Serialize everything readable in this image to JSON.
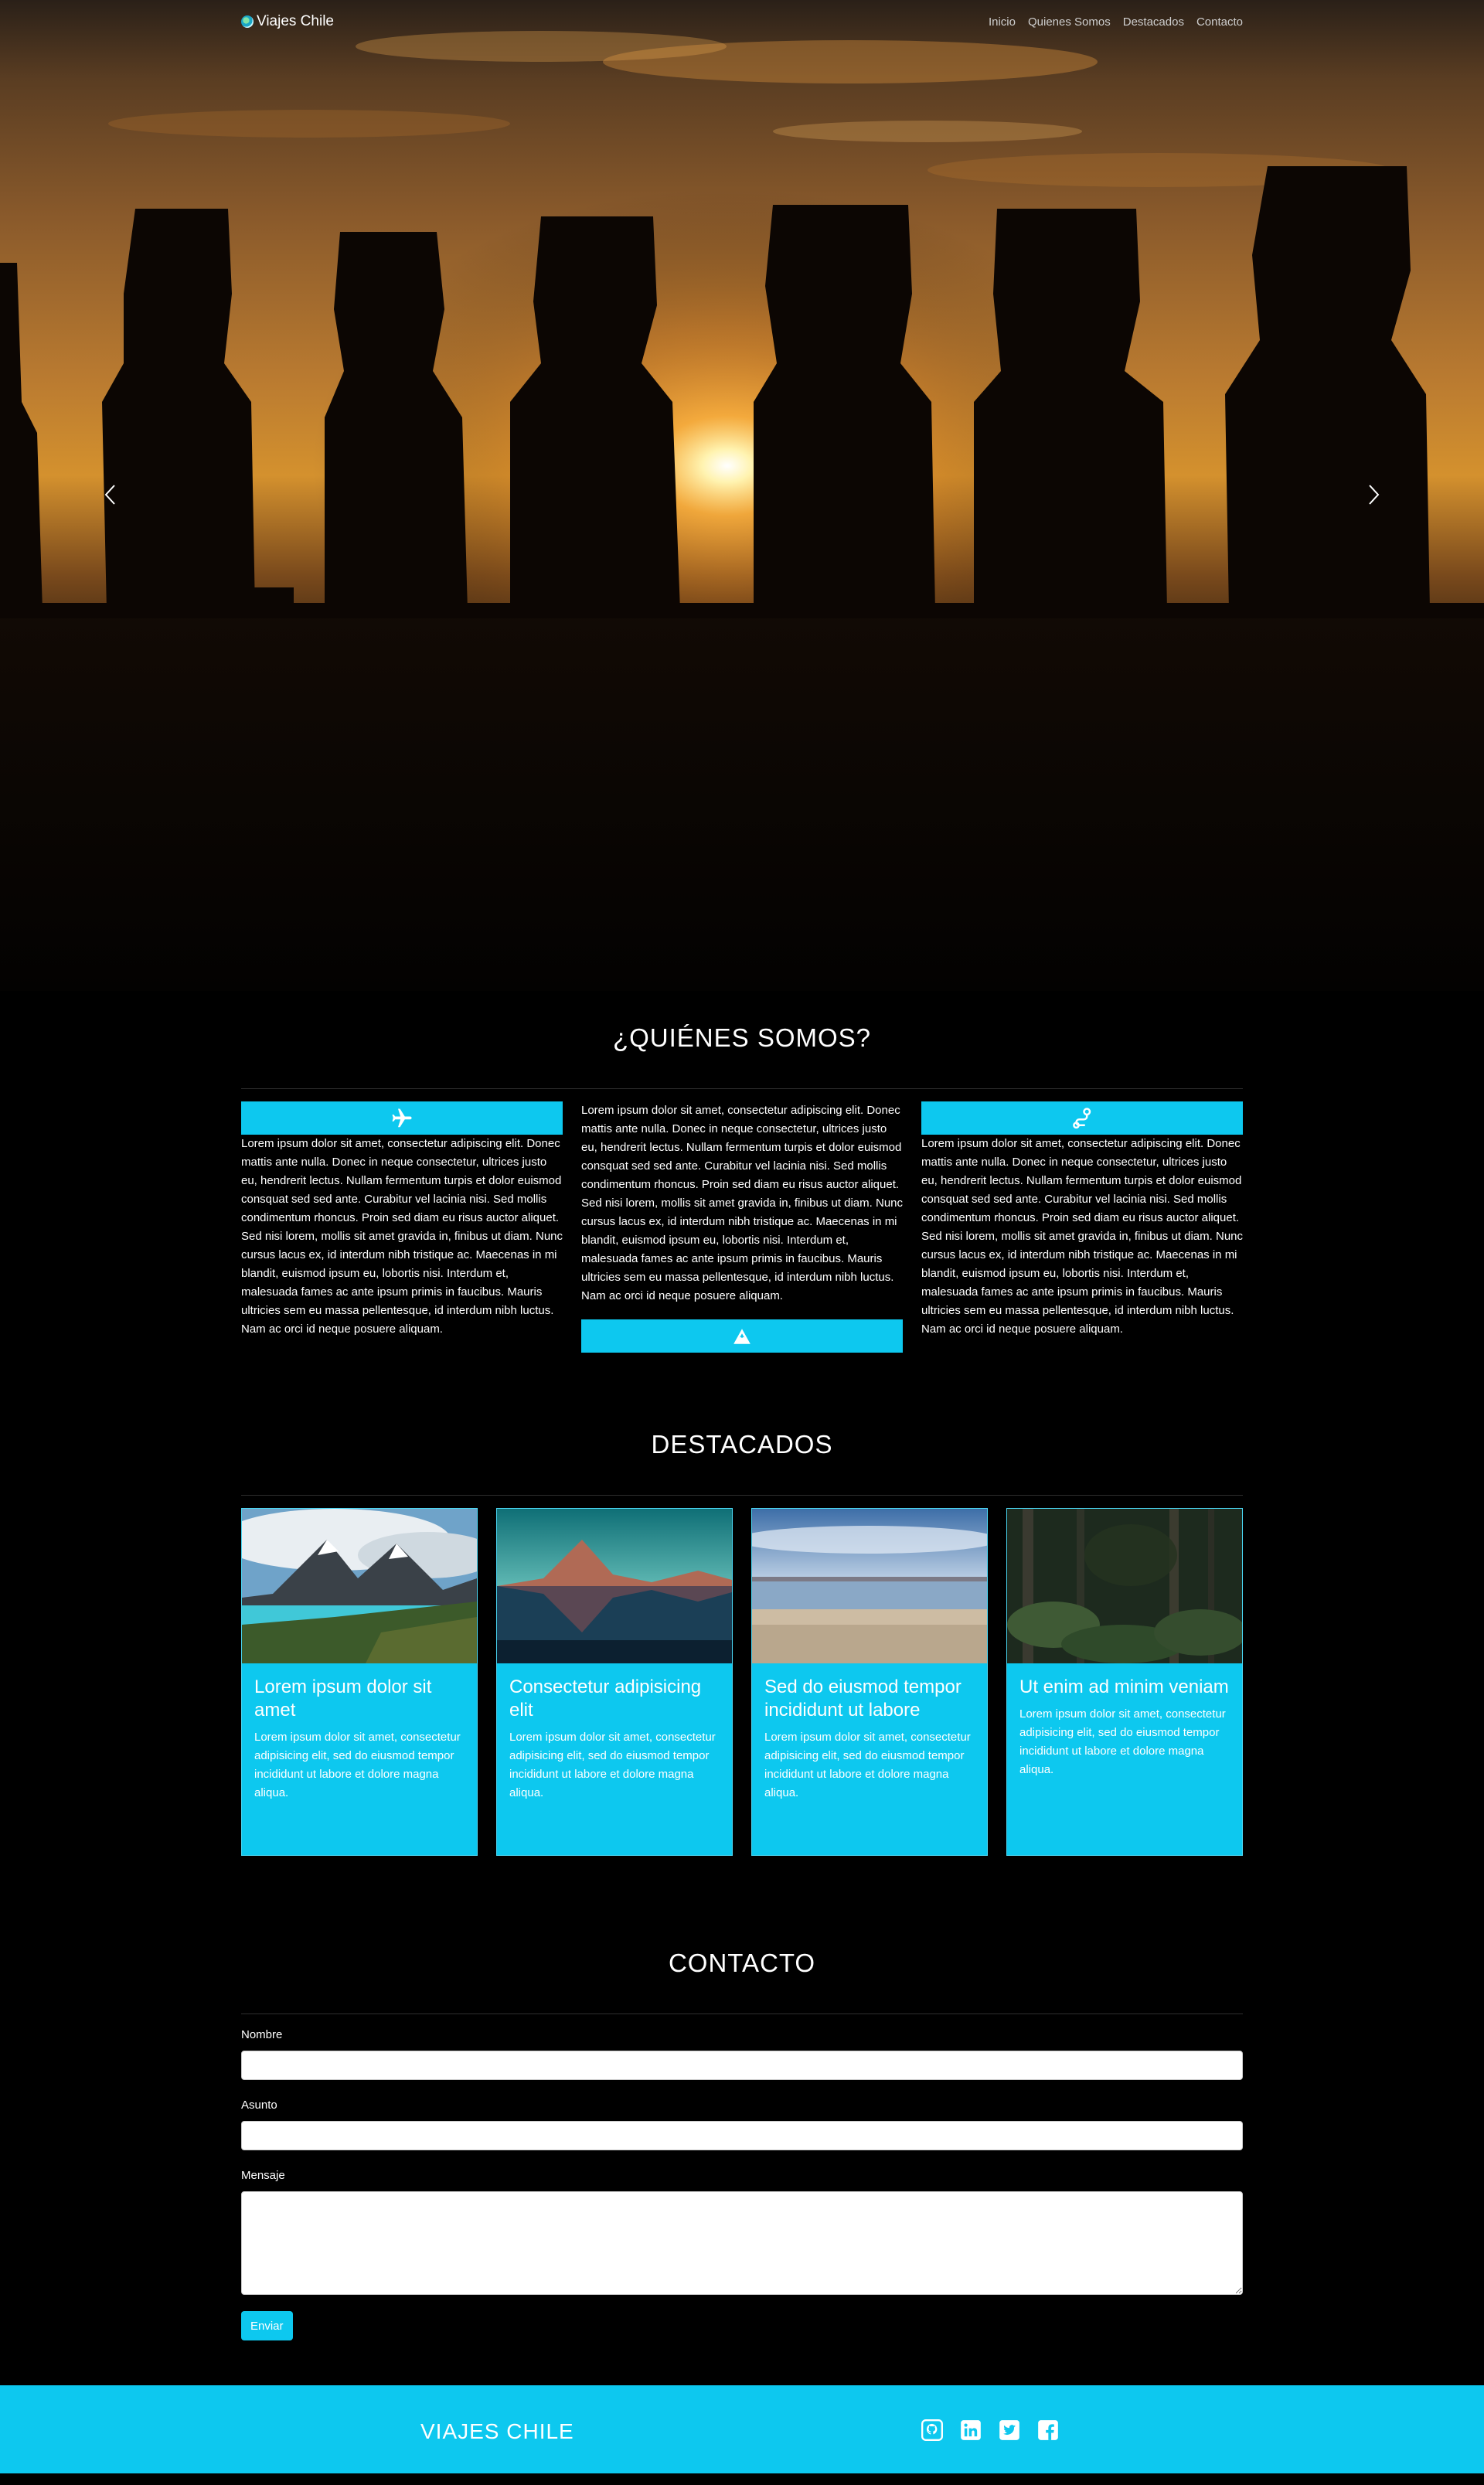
{
  "nav": {
    "brand": "Viajes Chile",
    "links": [
      "Inicio",
      "Quienes Somos",
      "Destacados",
      "Contacto"
    ]
  },
  "hero": {
    "image": "Silhouettes of moai statues against sunset",
    "prev_icon": "chevron-left-icon",
    "next_icon": "chevron-right-icon"
  },
  "about": {
    "title": "¿QUIÉNES SOMOS?",
    "text": "Lorem ipsum dolor sit amet, consectetur adipiscing elit. Donec mattis ante nulla. Donec in neque consectetur, ultrices justo eu, hendrerit lectus. Nullam fermentum turpis et dolor euismod consquat sed sed ante. Curabitur vel lacinia nisi. Sed mollis condimentum rhoncus. Proin sed diam eu risus auctor aliquet. Sed nisi lorem, mollis sit amet gravida in, finibus ut diam. Nunc cursus lacus ex, id interdum nibh tristique ac. Maecenas in mi blandit, euismod ipsum eu, lobortis nisi. Interdum et, malesuada fames ac ante ipsum primis in faucibus. Mauris ultricies sem eu massa pellentesque, id interdum nibh luctus. Nam ac orci id neque posuere aliquam.",
    "icons": [
      "plane-icon",
      "mountain-icon",
      "route-icon"
    ]
  },
  "featured": {
    "title": "DESTACADOS",
    "cards": [
      {
        "title": "Lorem ipsum dolor sit amet",
        "text": "Lorem ipsum dolor sit amet, consectetur adipisicing elit, sed do eiusmod tempor incididunt ut labore et dolore magna aliqua."
      },
      {
        "title": "Consectetur adipisicing elit",
        "text": "Lorem ipsum dolor sit amet, consectetur adipisicing elit, sed do eiusmod tempor incididunt ut labore et dolore magna aliqua."
      },
      {
        "title": "Sed do eiusmod tempor incididunt ut labore",
        "text": "Lorem ipsum dolor sit amet, consectetur adipisicing elit, sed do eiusmod tempor incididunt ut labore et dolore magna aliqua."
      },
      {
        "title": "Ut enim ad minim veniam",
        "text": "Lorem ipsum dolor sit amet, consectetur adipisicing elit, sed do eiusmod tempor incididunt ut labore et dolore magna aliqua."
      }
    ]
  },
  "contact": {
    "title": "CONTACTO",
    "name_label": "Nombre",
    "subject_label": "Asunto",
    "message_label": "Mensaje",
    "name_value": "",
    "subject_value": "",
    "message_value": "",
    "submit_label": "Enviar"
  },
  "footer": {
    "title": "VIAJES CHILE",
    "social_icons": [
      "github-icon",
      "linkedin-icon",
      "twitter-icon",
      "facebook-icon"
    ]
  },
  "colors": {
    "accent": "#0dc8ef",
    "background": "#000000"
  }
}
